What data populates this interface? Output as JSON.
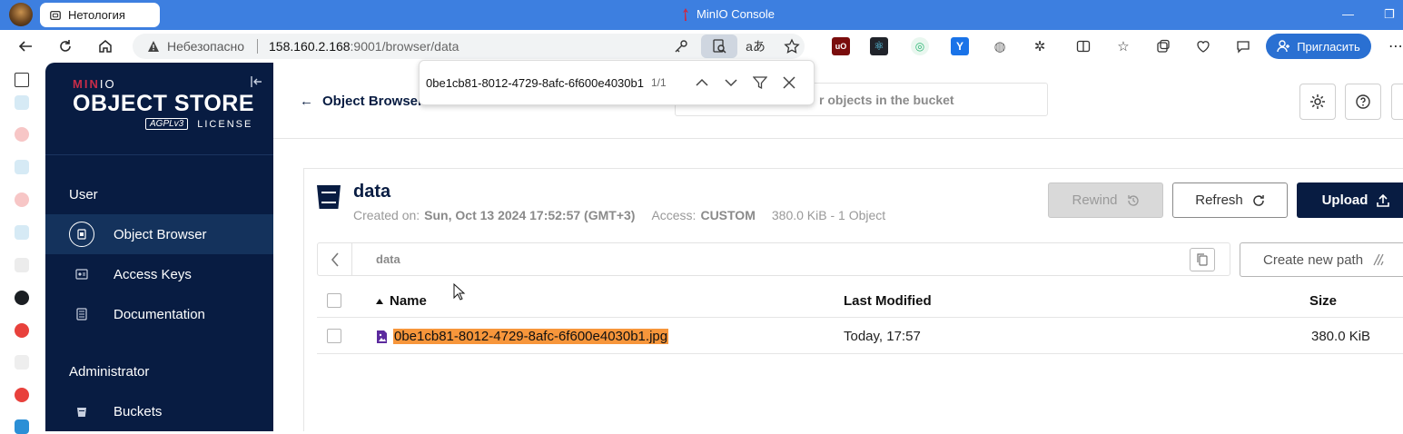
{
  "browser": {
    "tab_title": "Нетология",
    "window_title": "MinIO Console",
    "address": {
      "insecure_label": "Небезопасно",
      "host": "158.160.2.168",
      "path": ":9001/browser/data"
    },
    "invite_label": "Пригласить"
  },
  "find_bar": {
    "query": "0be1cb81-8012-4729-8afc-6f600e4030b1.jpg",
    "count": "1/1"
  },
  "sidebar": {
    "logo_brand": "MINIO",
    "logo_product": "OBJECT STORE",
    "logo_badge": "AGPLv3",
    "logo_license": "LICENSE",
    "sections": [
      {
        "title": "User"
      },
      {
        "title": "Administrator"
      }
    ],
    "items": [
      {
        "label": "Object Browser",
        "icon": "object-browser-icon",
        "active": true
      },
      {
        "label": "Access Keys",
        "icon": "access-keys-icon",
        "active": false
      },
      {
        "label": "Documentation",
        "icon": "documentation-icon",
        "active": false
      },
      {
        "label": "Buckets",
        "icon": "buckets-icon",
        "active": false
      }
    ]
  },
  "header": {
    "back_label": "Object Browser",
    "search_placeholder": "r objects in the bucket"
  },
  "bucket": {
    "name": "data",
    "created_label": "Created on:",
    "created_value": "Sun, Oct 13 2024 17:52:57 (GMT+3)",
    "access_label": "Access:",
    "access_value": "CUSTOM",
    "summary": "380.0 KiB - 1 Object"
  },
  "actions": {
    "rewind": "Rewind",
    "refresh": "Refresh",
    "upload": "Upload"
  },
  "breadcrumb": {
    "path": "data",
    "new_path_label": "Create new path"
  },
  "table": {
    "columns": [
      "Name",
      "Last Modified",
      "Size"
    ],
    "rows": [
      {
        "name": "0be1cb81-8012-4729-8afc-6f600e4030b1.jpg",
        "modified": "Today, 17:57",
        "size": "380.0 KiB"
      }
    ]
  },
  "colors": {
    "sidebar_bg": "#081c42",
    "accent": "#c72c48",
    "highlight": "#f7963b",
    "titlebar": "#3d7fe0"
  }
}
